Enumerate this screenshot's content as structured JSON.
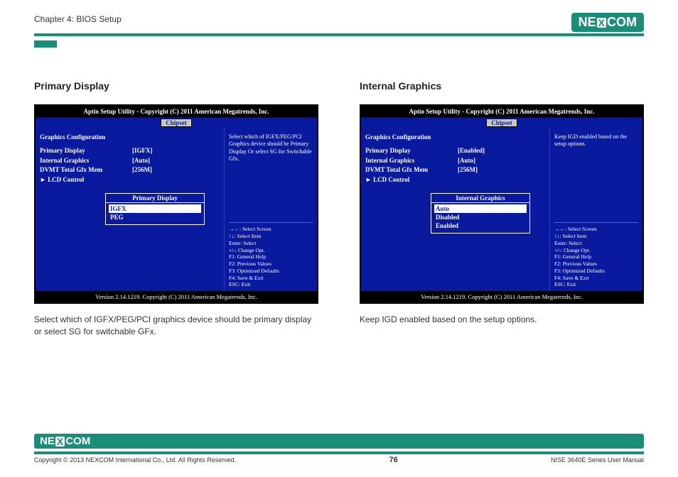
{
  "header": {
    "chapter": "Chapter 4: BIOS Setup",
    "brand_left": "NE",
    "brand_x": "X",
    "brand_right": "COM"
  },
  "sections": [
    {
      "title": "Primary Display",
      "desc": "Select which of IGFX/PEG/PCI graphics device should be primary display or select SG for switchable GFx.",
      "bios": {
        "titlebar": "Aptio Setup Utility - Copyright (C) 2011 American Megatrends, Inc.",
        "tab": "Chipset",
        "cfg_title": "Graphics Configuration",
        "rows": [
          {
            "lbl": "Primary Display",
            "val": "[IGFX]"
          },
          {
            "lbl": "Internal Graphics",
            "val": "[Auto]"
          },
          {
            "lbl": "DVMT Total Gfx Mem",
            "val": "[256M]"
          },
          {
            "lbl": "► LCD Control",
            "val": ""
          }
        ],
        "popup": {
          "title": "Primary Display",
          "options": [
            "IGFX",
            "PEG"
          ],
          "selected": "IGFX"
        },
        "help": "Select which of IGFX/PEG/PCI Graphics device should be Primary Display Or select SG for Switchable Gfx.",
        "keys": [
          "→←: Select Screen",
          "↑↓: Select Item",
          "Enter: Select",
          "+/-: Change Opt.",
          "F1: General Help",
          "F2: Previous Values",
          "F3: Optimized Defaults",
          "F4: Save & Exit",
          "ESC: Exit"
        ],
        "footer": "Version 2.14.1219. Copyright (C) 2011 American Megatrends, Inc."
      }
    },
    {
      "title": "Internal Graphics",
      "desc": "Keep IGD enabled based on the setup options.",
      "bios": {
        "titlebar": "Aptio Setup Utility - Copyright (C) 2011 American Megatrends, Inc.",
        "tab": "Chipset",
        "cfg_title": "Graphics Configuration",
        "rows": [
          {
            "lbl": "Primary Display",
            "val": "[Enabled]"
          },
          {
            "lbl": "Internal Graphics",
            "val": "[Auto]"
          },
          {
            "lbl": "DVMT Total Gfx Mem",
            "val": "[256M]"
          },
          {
            "lbl": "► LCD Control",
            "val": ""
          }
        ],
        "popup": {
          "title": "Internal Graphics",
          "options": [
            "Auto",
            "Disabled",
            "Enabled"
          ],
          "selected": "Auto"
        },
        "help": "Keep IGD enabled based on the setup options.",
        "keys": [
          "→←: Select Screen",
          "↑↓: Select Item",
          "Enter: Select",
          "+/-: Change Opt.",
          "F1: General Help",
          "F2: Previous Values",
          "F3: Optimized Defaults",
          "F4: Save & Exit",
          "ESC: Exit"
        ],
        "footer": "Version 2.14.1219. Copyright (C) 2011 American Megatrends, Inc."
      }
    }
  ],
  "footer": {
    "copyright": "Copyright © 2013 NEXCOM International Co., Ltd. All Rights Reserved.",
    "page": "76",
    "manual": "NISE 3640E Series User Manual"
  }
}
